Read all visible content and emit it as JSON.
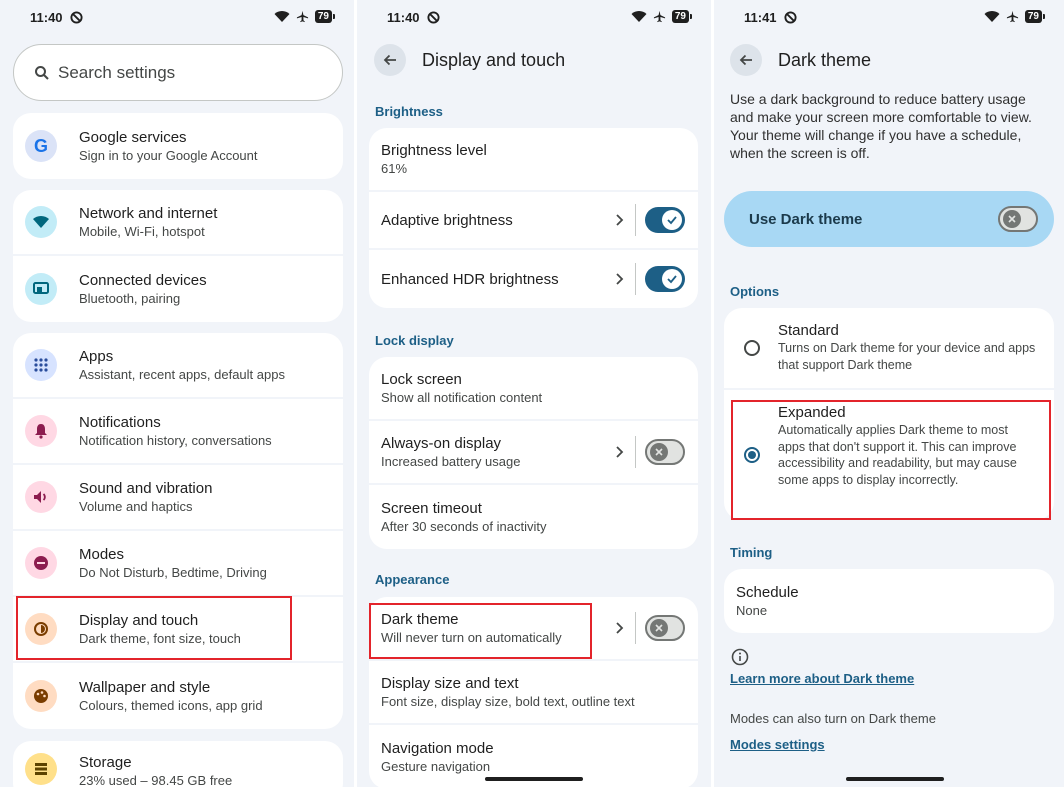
{
  "colors": {
    "background": "#f1f4f9",
    "card": "#ffffff",
    "accent": "#1d5f86",
    "highlight": "#e3242b",
    "dark_theme_pill": "#a8d8f4"
  },
  "screen1": {
    "status": {
      "time": "11:40",
      "battery": "79"
    },
    "search": {
      "icon": "search-icon",
      "placeholder": "Search settings"
    },
    "groups": [
      [
        {
          "icon": "google-icon",
          "title": "Google services",
          "subtitle": "Sign in to your Google Account"
        }
      ],
      [
        {
          "icon": "wifi-icon",
          "title": "Network and internet",
          "subtitle": "Mobile, Wi-Fi, hotspot"
        },
        {
          "icon": "devices-icon",
          "title": "Connected devices",
          "subtitle": "Bluetooth, pairing"
        }
      ],
      [
        {
          "icon": "apps-icon",
          "title": "Apps",
          "subtitle": "Assistant, recent apps, default apps"
        },
        {
          "icon": "bell-icon",
          "title": "Notifications",
          "subtitle": "Notification history, conversations"
        },
        {
          "icon": "volume-icon",
          "title": "Sound and vibration",
          "subtitle": "Volume and haptics"
        },
        {
          "icon": "modes-icon",
          "title": "Modes",
          "subtitle": "Do Not Disturb, Bedtime, Driving"
        },
        {
          "icon": "display-icon",
          "title": "Display and touch",
          "subtitle": "Dark theme, font size, touch"
        },
        {
          "icon": "palette-icon",
          "title": "Wallpaper and style",
          "subtitle": "Colours, themed icons, app grid"
        }
      ],
      [
        {
          "icon": "storage-icon",
          "title": "Storage",
          "subtitle": "23% used – 98.45 GB free"
        }
      ]
    ]
  },
  "screen2": {
    "status": {
      "time": "11:40",
      "battery": "79"
    },
    "title": "Display and touch",
    "sections": {
      "brightness": "Brightness",
      "lock_display": "Lock display",
      "appearance": "Appearance"
    },
    "brightness_items": {
      "level": {
        "title": "Brightness level",
        "subtitle": "61%"
      },
      "adaptive": {
        "title": "Adaptive brightness",
        "on": true
      },
      "hdr": {
        "title": "Enhanced HDR brightness",
        "on": true
      }
    },
    "lock_items": {
      "lock_screen": {
        "title": "Lock screen",
        "subtitle": "Show all notification content"
      },
      "aod": {
        "title": "Always-on display",
        "subtitle": "Increased battery usage",
        "on": false
      },
      "timeout": {
        "title": "Screen timeout",
        "subtitle": "After 30 seconds of inactivity"
      }
    },
    "appearance_items": {
      "dark": {
        "title": "Dark theme",
        "subtitle": "Will never turn on automatically",
        "on": false
      },
      "size": {
        "title": "Display size and text",
        "subtitle": "Font size, display size, bold text, outline text"
      },
      "nav": {
        "title": "Navigation mode",
        "subtitle": "Gesture navigation"
      }
    }
  },
  "screen3": {
    "status": {
      "time": "11:41",
      "battery": "79"
    },
    "title": "Dark theme",
    "description": "Use a dark background to reduce battery usage and make your screen more comfortable to view. Your theme will change if you have a schedule, when the screen is off.",
    "use_dark_label": "Use Dark theme",
    "use_dark_on": false,
    "options_label": "Options",
    "options": {
      "standard": {
        "title": "Standard",
        "subtitle": "Turns on Dark theme for your device and apps that support Dark theme",
        "selected": false
      },
      "expanded": {
        "title": "Expanded",
        "subtitle": "Automatically applies Dark theme to most apps that don't support it. This can improve accessibility and readability, but may cause some apps to display incorrectly.",
        "selected": true
      }
    },
    "timing_label": "Timing",
    "schedule": {
      "title": "Schedule",
      "subtitle": "None"
    },
    "learn_more": "Learn more about Dark theme",
    "modes_note": "Modes can also turn on Dark theme",
    "modes_settings": "Modes settings"
  }
}
